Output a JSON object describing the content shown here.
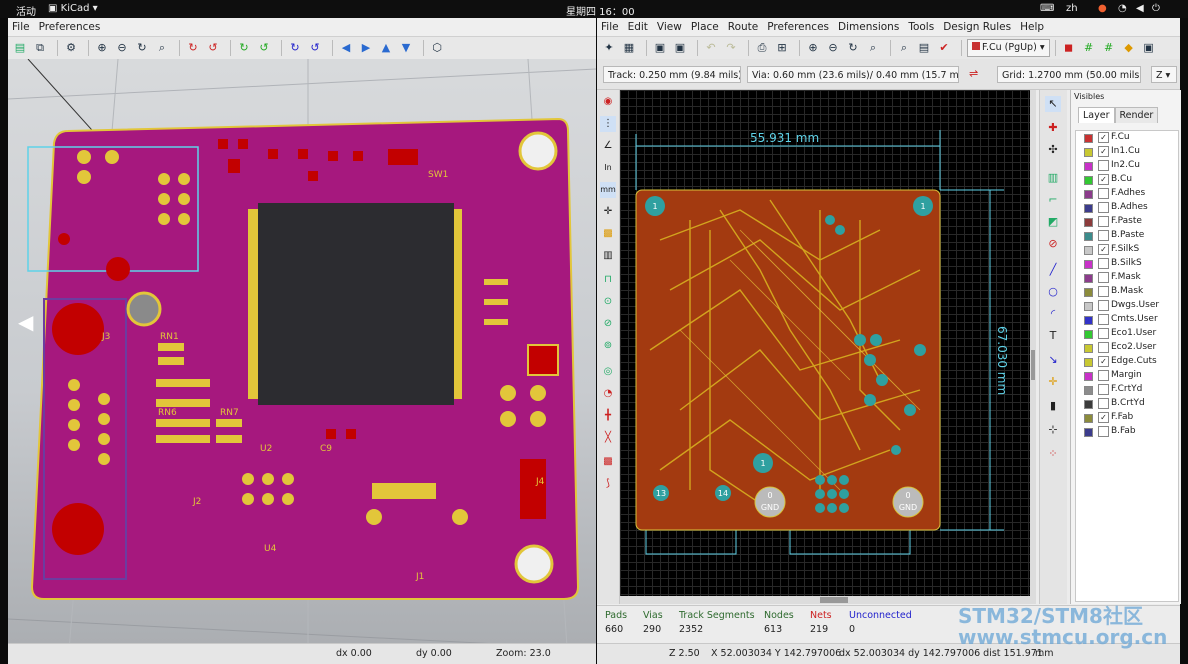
{
  "system_bar": {
    "activities": "活动",
    "app": "KiCad",
    "clock": "星期四 16：00",
    "lang": "zh"
  },
  "viewer3d": {
    "menu": [
      "File",
      "Preferences"
    ],
    "status": {
      "dx": "dx 0.00",
      "dy": "dy 0.00",
      "zoom": "Zoom: 23.0"
    },
    "board_labels": [
      "SW1",
      "J2",
      "J4",
      "J1",
      "U4",
      "RN1",
      "RN6",
      "RN7",
      "C9",
      "J3",
      "U2"
    ]
  },
  "pcbnew": {
    "menu": [
      "File",
      "Edit",
      "View",
      "Place",
      "Route",
      "Preferences",
      "Dimensions",
      "Tools",
      "Design Rules",
      "Help"
    ],
    "active_layer": "F.Cu (PgUp)",
    "track": "Track: 0.250 mm (9.84 mils) *",
    "via": "Via: 0.60 mm (23.6 mils)/ 0.40 mm (15.7 mils) *",
    "grid": "Grid: 1.2700 mm (50.00 mils)",
    "zoom_combo": "Z",
    "dimension_h": "55.931 mm",
    "dimension_v": "67.030 mm",
    "canvas_labels": [
      "1",
      "1",
      "1",
      "13",
      "14",
      "0",
      "GND",
      "0",
      "GND"
    ],
    "panel": {
      "title": "Visibles",
      "tabs": [
        "Layer",
        "Render"
      ],
      "layers": [
        {
          "name": "F.Cu",
          "checked": true,
          "color": "#c83232"
        },
        {
          "name": "In1.Cu",
          "checked": true,
          "color": "#c8c832"
        },
        {
          "name": "In2.Cu",
          "checked": false,
          "color": "#c832c8"
        },
        {
          "name": "B.Cu",
          "checked": true,
          "color": "#32c832"
        },
        {
          "name": "F.Adhes",
          "checked": false,
          "color": "#8c3c8c"
        },
        {
          "name": "B.Adhes",
          "checked": false,
          "color": "#3c3c8c"
        },
        {
          "name": "F.Paste",
          "checked": false,
          "color": "#8c3c3c"
        },
        {
          "name": "B.Paste",
          "checked": false,
          "color": "#3c8c8c"
        },
        {
          "name": "F.SilkS",
          "checked": true,
          "color": "#c8c8c8"
        },
        {
          "name": "B.SilkS",
          "checked": false,
          "color": "#c832c8"
        },
        {
          "name": "F.Mask",
          "checked": false,
          "color": "#8c3c8c"
        },
        {
          "name": "B.Mask",
          "checked": false,
          "color": "#8c8c3c"
        },
        {
          "name": "Dwgs.User",
          "checked": false,
          "color": "#c8c8c8"
        },
        {
          "name": "Cmts.User",
          "checked": false,
          "color": "#3232c8"
        },
        {
          "name": "Eco1.User",
          "checked": false,
          "color": "#32c832"
        },
        {
          "name": "Eco2.User",
          "checked": false,
          "color": "#c8c832"
        },
        {
          "name": "Edge.Cuts",
          "checked": true,
          "color": "#c8c832"
        },
        {
          "name": "Margin",
          "checked": false,
          "color": "#c832c8"
        },
        {
          "name": "F.CrtYd",
          "checked": false,
          "color": "#8c8c8c"
        },
        {
          "name": "B.CrtYd",
          "checked": false,
          "color": "#3c3c3c"
        },
        {
          "name": "F.Fab",
          "checked": true,
          "color": "#8c8c3c"
        },
        {
          "name": "B.Fab",
          "checked": false,
          "color": "#3c3c8c"
        }
      ]
    },
    "stats": [
      {
        "label": "Pads",
        "value": "660"
      },
      {
        "label": "Vias",
        "value": "290"
      },
      {
        "label": "Track Segments",
        "value": "2352"
      },
      {
        "label": "Nodes",
        "value": "613"
      },
      {
        "label": "Nets",
        "value": "219"
      },
      {
        "label": "Unconnected",
        "value": "0"
      }
    ],
    "status": {
      "zoom": "Z 2.50",
      "xy": "X 52.003034  Y 142.797006",
      "dxy": "dx 52.003034  dy 142.797006  dist 151.971",
      "units": "mm"
    }
  },
  "watermark": {
    "line1": "STM32/STM8社区",
    "line2": "www.stmcu.org.cn"
  }
}
